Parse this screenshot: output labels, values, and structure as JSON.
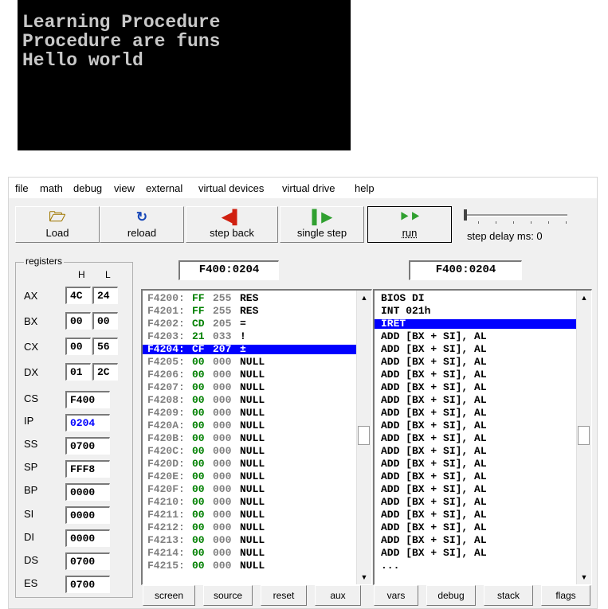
{
  "console": {
    "lines": [
      "Learning Procedure",
      "Procedure are funs",
      "Hello world"
    ]
  },
  "menu": [
    "file",
    "math",
    "debug",
    "view",
    "external",
    "virtual devices",
    "virtual drive",
    "help"
  ],
  "toolbar": {
    "load": "Load",
    "reload": "reload",
    "step_back": "step back",
    "single_step": "single step",
    "run": "run",
    "step_delay": "step delay ms: 0",
    "step_delay_ms": 0
  },
  "registers": {
    "title": "registers",
    "h_label": "H",
    "l_label": "L",
    "AX": {
      "name": "AX",
      "H": "4C",
      "L": "24"
    },
    "BX": {
      "name": "BX",
      "H": "00",
      "L": "00"
    },
    "CX": {
      "name": "CX",
      "H": "00",
      "L": "56"
    },
    "DX": {
      "name": "DX",
      "H": "01",
      "L": "2C"
    },
    "CS": {
      "name": "CS",
      "value": "F400"
    },
    "IP": {
      "name": "IP",
      "value": "0204"
    },
    "SS": {
      "name": "SS",
      "value": "0700"
    },
    "SP": {
      "name": "SP",
      "value": "FFF8"
    },
    "BP": {
      "name": "BP",
      "value": "0000"
    },
    "SI": {
      "name": "SI",
      "value": "0000"
    },
    "DI": {
      "name": "DI",
      "value": "0000"
    },
    "DS": {
      "name": "DS",
      "value": "0700"
    },
    "ES": {
      "name": "ES",
      "value": "0700"
    }
  },
  "memory": {
    "address": "F400:0204",
    "rows": [
      {
        "addr": "F4200:",
        "hex": "FF",
        "dec": "255",
        "ch": "RES"
      },
      {
        "addr": "F4201:",
        "hex": "FF",
        "dec": "255",
        "ch": "RES"
      },
      {
        "addr": "F4202:",
        "hex": "CD",
        "dec": "205",
        "ch": "="
      },
      {
        "addr": "F4203:",
        "hex": "21",
        "dec": "033",
        "ch": "!"
      },
      {
        "addr": "F4204:",
        "hex": "CF",
        "dec": "207",
        "ch": "±"
      },
      {
        "addr": "F4205:",
        "hex": "00",
        "dec": "000",
        "ch": "NULL"
      },
      {
        "addr": "F4206:",
        "hex": "00",
        "dec": "000",
        "ch": "NULL"
      },
      {
        "addr": "F4207:",
        "hex": "00",
        "dec": "000",
        "ch": "NULL"
      },
      {
        "addr": "F4208:",
        "hex": "00",
        "dec": "000",
        "ch": "NULL"
      },
      {
        "addr": "F4209:",
        "hex": "00",
        "dec": "000",
        "ch": "NULL"
      },
      {
        "addr": "F420A:",
        "hex": "00",
        "dec": "000",
        "ch": "NULL"
      },
      {
        "addr": "F420B:",
        "hex": "00",
        "dec": "000",
        "ch": "NULL"
      },
      {
        "addr": "F420C:",
        "hex": "00",
        "dec": "000",
        "ch": "NULL"
      },
      {
        "addr": "F420D:",
        "hex": "00",
        "dec": "000",
        "ch": "NULL"
      },
      {
        "addr": "F420E:",
        "hex": "00",
        "dec": "000",
        "ch": "NULL"
      },
      {
        "addr": "F420F:",
        "hex": "00",
        "dec": "000",
        "ch": "NULL"
      },
      {
        "addr": "F4210:",
        "hex": "00",
        "dec": "000",
        "ch": "NULL"
      },
      {
        "addr": "F4211:",
        "hex": "00",
        "dec": "000",
        "ch": "NULL"
      },
      {
        "addr": "F4212:",
        "hex": "00",
        "dec": "000",
        "ch": "NULL"
      },
      {
        "addr": "F4213:",
        "hex": "00",
        "dec": "000",
        "ch": "NULL"
      },
      {
        "addr": "F4214:",
        "hex": "00",
        "dec": "000",
        "ch": "NULL"
      },
      {
        "addr": "F4215:",
        "hex": "00",
        "dec": "000",
        "ch": "NULL"
      }
    ],
    "selected_index": 4
  },
  "disasm": {
    "address": "F400:0204",
    "rows": [
      "BIOS DI",
      "INT 021h",
      "IRET",
      "ADD [BX + SI], AL",
      "ADD [BX + SI], AL",
      "ADD [BX + SI], AL",
      "ADD [BX + SI], AL",
      "ADD [BX + SI], AL",
      "ADD [BX + SI], AL",
      "ADD [BX + SI], AL",
      "ADD [BX + SI], AL",
      "ADD [BX + SI], AL",
      "ADD [BX + SI], AL",
      "ADD [BX + SI], AL",
      "ADD [BX + SI], AL",
      "ADD [BX + SI], AL",
      "ADD [BX + SI], AL",
      "ADD [BX + SI], AL",
      "ADD [BX + SI], AL",
      "ADD [BX + SI], AL",
      "ADD [BX + SI], AL",
      "..."
    ],
    "selected_index": 2
  },
  "bottom_buttons": [
    "screen",
    "source",
    "reset",
    "aux",
    "vars",
    "debug",
    "stack",
    "flags"
  ]
}
